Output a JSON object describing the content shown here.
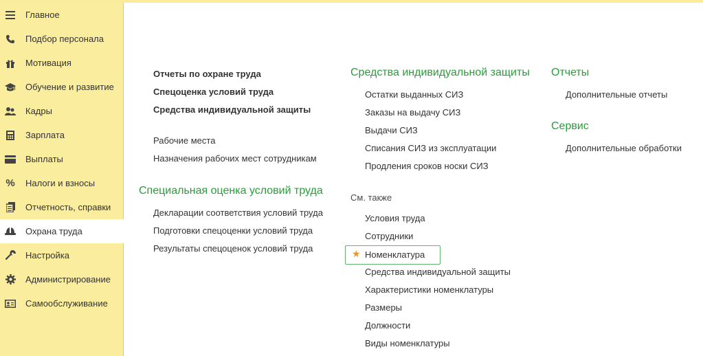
{
  "sidebar": {
    "items": [
      {
        "label": "Главное",
        "icon": "menu-lines-icon",
        "active": false
      },
      {
        "label": "Подбор персонала",
        "icon": "phone-icon",
        "active": false
      },
      {
        "label": "Мотивация",
        "icon": "gift-icon",
        "active": false
      },
      {
        "label": "Обучение и развитие",
        "icon": "graduation-cap-icon",
        "active": false
      },
      {
        "label": "Кадры",
        "icon": "people-icon",
        "active": false
      },
      {
        "label": "Зарплата",
        "icon": "calculator-icon",
        "active": false
      },
      {
        "label": "Выплаты",
        "icon": "card-icon",
        "active": false
      },
      {
        "label": "Налоги и взносы",
        "icon": "percent-icon",
        "active": false
      },
      {
        "label": "Отчетность, справки",
        "icon": "documents-icon",
        "active": false
      },
      {
        "label": "Охрана труда",
        "icon": "hard-hat-icon",
        "active": true
      },
      {
        "label": "Настройка",
        "icon": "wrench-icon",
        "active": false
      },
      {
        "label": "Администрирование",
        "icon": "gear-icon",
        "active": false
      },
      {
        "label": "Самообслуживание",
        "icon": "id-card-icon",
        "active": false
      }
    ]
  },
  "col1": {
    "bold_links": [
      "Отчеты по охране труда",
      "Спецоценка условий труда",
      "Средства индивидуальной защиты"
    ],
    "links": [
      "Рабочие места",
      "Назначения рабочих мест сотрудникам"
    ],
    "section_title": "Специальная оценка условий труда",
    "section_links": [
      "Декларации соответствия условий труда",
      "Подготовки спецоценки условий труда",
      "Результаты спецоценок условий труда"
    ]
  },
  "col2": {
    "section_title": "Средства индивидуальной защиты",
    "section_links": [
      "Остатки выданных СИЗ",
      "Заказы на выдачу СИЗ",
      "Выдачи СИЗ",
      "Списания СИЗ из эксплуатации",
      "Продления сроков носки СИЗ"
    ],
    "see_also_label": "См. также",
    "see_also_links": [
      "Условия труда",
      "Сотрудники",
      "Номенклатура",
      "Средства индивидуальной защиты",
      "Характеристики номенклатуры",
      "Размеры",
      "Должности",
      "Виды номенклатуры"
    ]
  },
  "col3": {
    "reports_title": "Отчеты",
    "reports_links": [
      "Дополнительные отчеты"
    ],
    "service_title": "Сервис",
    "service_links": [
      "Дополнительные обработки"
    ]
  },
  "colors": {
    "accent_green": "#2a9d3a",
    "sidebar_bg": "#fbed9e",
    "star": "#e8962a"
  }
}
